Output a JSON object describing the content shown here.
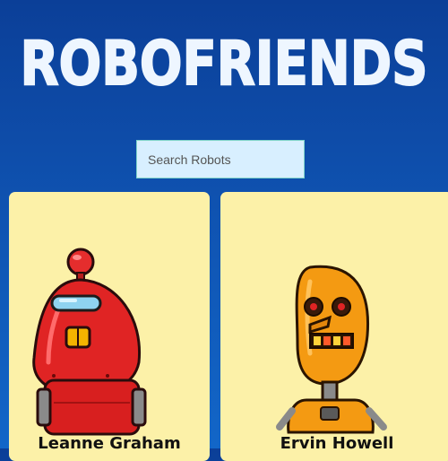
{
  "app": {
    "title": "ROBOFRIENDS",
    "title_color": "#eef6ff",
    "background_color": "#0f52b0"
  },
  "search": {
    "placeholder": "Search Robots",
    "value": ""
  },
  "robots": [
    {
      "name": "Leanne Graham",
      "avatar": "red-robot-avatar",
      "card_color": "#fcf1a8"
    },
    {
      "name": "Ervin Howell",
      "avatar": "orange-robot-avatar",
      "card_color": "#fcf1a8"
    }
  ]
}
